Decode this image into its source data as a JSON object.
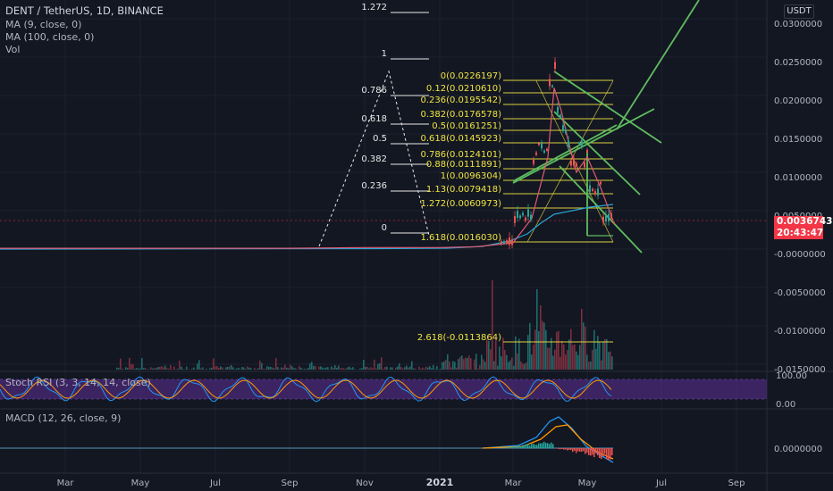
{
  "header": {
    "symbol_line": "DENT / TetherUS, 1D, BINANCE",
    "indicators": [
      "MA (9, close, 0)",
      "MA (100, close, 0)",
      "Vol"
    ],
    "currency": "USDT"
  },
  "price_axis": {
    "labels": [
      "0.0300000",
      "0.0250000",
      "0.0200000",
      "0.0150000",
      "0.0100000",
      "0.0050000",
      "-0.0000000",
      "-0.0050000",
      "-0.0100000",
      "-0.0150000"
    ],
    "current_price": "0.0036743",
    "countdown": "20:43:47"
  },
  "time_axis": {
    "labels": [
      "Mar",
      "May",
      "Jul",
      "Sep",
      "Nov",
      "2021",
      "Mar",
      "May",
      "Jul",
      "Sep"
    ]
  },
  "fib_left": {
    "levels": [
      {
        "label": "1.272",
        "value": 1.272
      },
      {
        "label": "1",
        "value": 1
      },
      {
        "label": "0.786",
        "value": 0.786
      },
      {
        "label": "0.618",
        "value": 0.618
      },
      {
        "label": "0.5",
        "value": 0.5
      },
      {
        "label": "0.382",
        "value": 0.382
      },
      {
        "label": "0.236",
        "value": 0.236
      },
      {
        "label": "0",
        "value": 0
      }
    ]
  },
  "fib_right": {
    "levels": [
      {
        "label": "0(0.0226197)",
        "value": 0.0226197
      },
      {
        "label": "0.12(0.0210610)",
        "value": 0.021061
      },
      {
        "label": "0.236(0.0195542)",
        "value": 0.0195542
      },
      {
        "label": "0.382(0.0176578)",
        "value": 0.0176578
      },
      {
        "label": "0.5(0.0161251)",
        "value": 0.0161251
      },
      {
        "label": "0.618(0.0145923)",
        "value": 0.0145923
      },
      {
        "label": "0.786(0.0124101)",
        "value": 0.0124101
      },
      {
        "label": "0.88(0.0111891)",
        "value": 0.0111891
      },
      {
        "label": "1(0.0096304)",
        "value": 0.0096304
      },
      {
        "label": "1.13(0.0079418)",
        "value": 0.0079418
      },
      {
        "label": "1.272(0.0060973)",
        "value": 0.0060973
      },
      {
        "label": "1.618(0.0016030)",
        "value": 0.001603
      },
      {
        "label": "2.618(-0.0113864)",
        "value": -0.0113864
      }
    ]
  },
  "stoch_rsi": {
    "title": "Stoch RSI (3, 3, 14, 14, close)",
    "axis_labels": [
      "100.00",
      "0.00"
    ]
  },
  "macd": {
    "title": "MACD (12, 26, close, 9)",
    "axis_labels": [
      "0.0000000"
    ]
  },
  "colors": {
    "background": "#131722",
    "fib_yellow": "#f0e442",
    "trend_green": "#5fbd5f",
    "ma_fast": "#e25a73",
    "ma_slow": "#26a6d6",
    "stoch_band": "#4b2a78",
    "price_badge": "#f23645"
  },
  "chart_data": {
    "type": "line",
    "title": "DENT / TetherUS, 1D, BINANCE",
    "xlabel": "",
    "ylabel": "",
    "ylim": [
      -0.016,
      0.032
    ],
    "x": [
      "2020-02",
      "2020-03",
      "2020-05",
      "2020-07",
      "2020-09",
      "2020-11",
      "2021-01",
      "2021-02",
      "2021-03",
      "2021-03-20",
      "2021-04-05",
      "2021-04-10",
      "2021-04-15",
      "2021-04-20",
      "2021-04-25",
      "2021-05-01",
      "2021-05-10",
      "2021-05-18"
    ],
    "series": [
      {
        "values": [
          0.0001,
          0.0001,
          0.0001,
          0.0001,
          0.0001,
          0.0002,
          0.0002,
          0.0003,
          0.0008,
          0.004,
          0.012,
          0.021,
          0.018,
          0.014,
          0.01,
          0.012,
          0.008,
          0.0037
        ]
      }
    ]
  }
}
